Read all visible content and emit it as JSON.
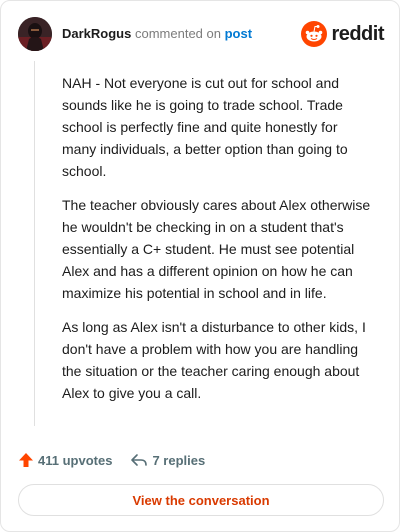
{
  "header": {
    "username": "DarkRogus",
    "verb": "commented on",
    "target_link": "post",
    "brand": "reddit",
    "brand_color": "#ff4500"
  },
  "comment": {
    "paragraphs": [
      "NAH - Not everyone is cut out for school and sounds like he is going to trade school. Trade school is perfectly fine and quite honestly for many individuals, a better option than going to school.",
      "The teacher obviously cares about Alex otherwise he wouldn't be checking in on a student that's essentially a C+ student. He must see potential Alex and has a different opinion on how he can maximize his potential in school and in life.",
      "As long as Alex isn't a disturbance to other kids, I don't have a problem with how you are handling the situation or the teacher caring enough about Alex to give you a call."
    ]
  },
  "actions": {
    "upvotes": "411 upvotes",
    "replies": "7 replies",
    "upvote_icon": "upvote-arrow-icon",
    "reply_icon": "reply-arrow-icon"
  },
  "cta": {
    "label": "View the conversation"
  }
}
